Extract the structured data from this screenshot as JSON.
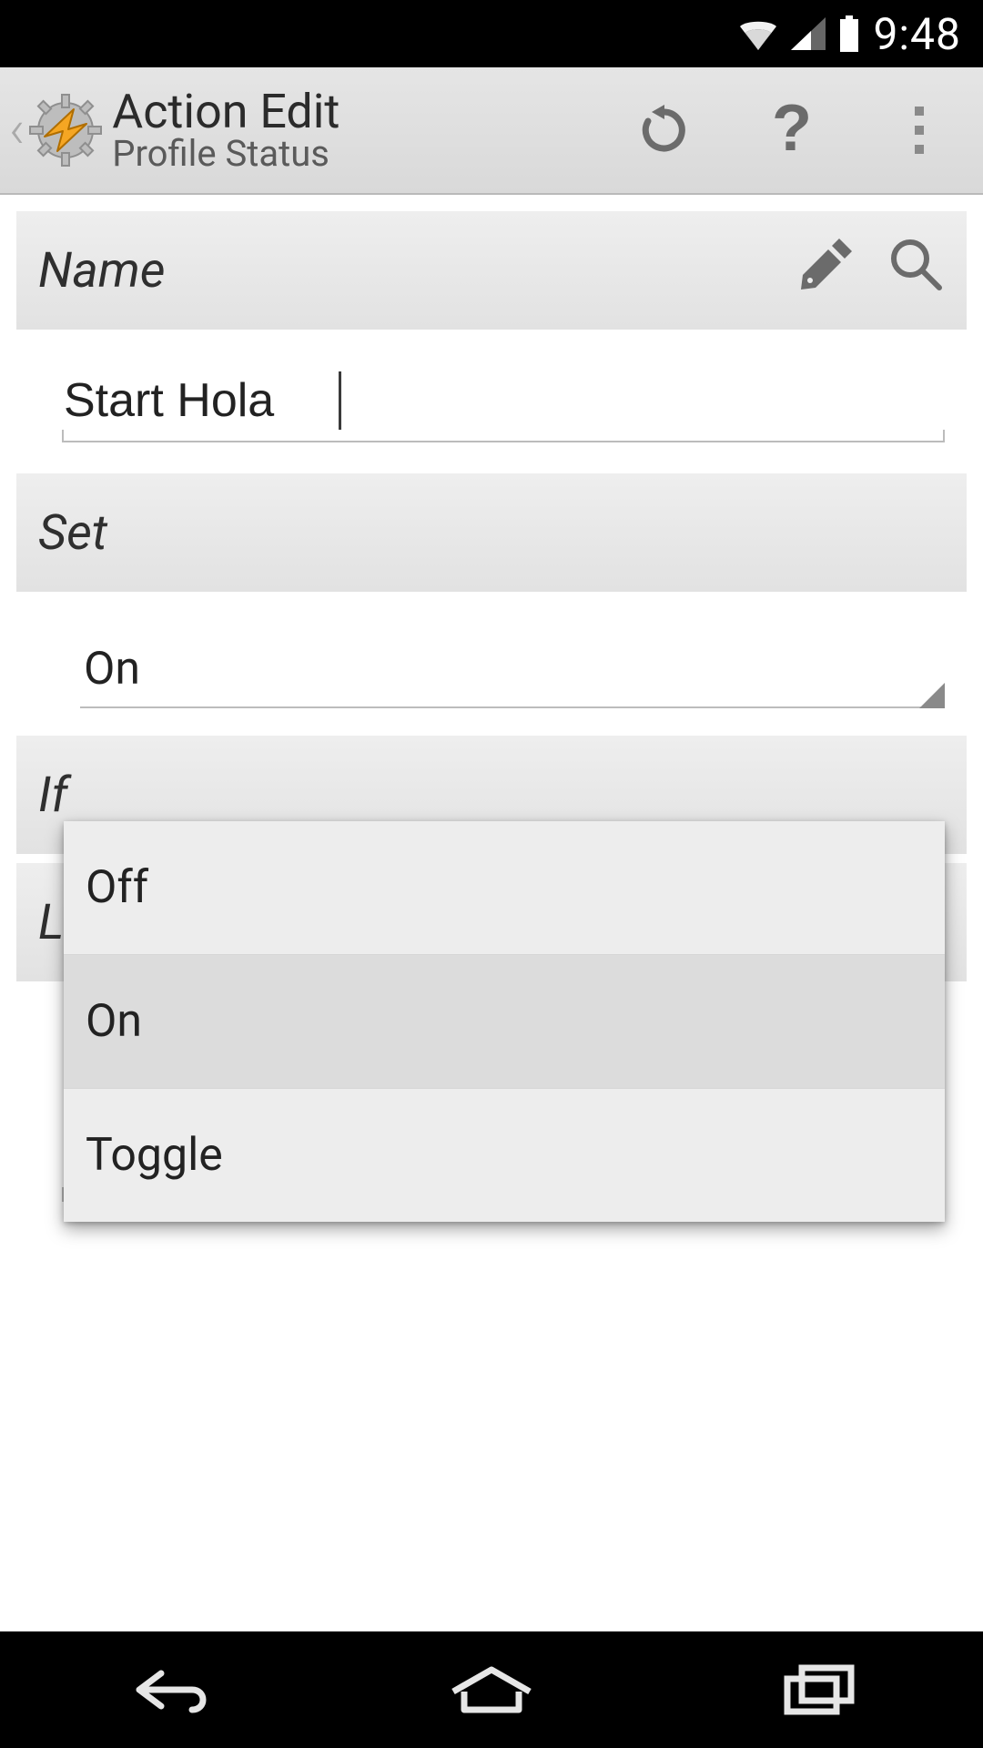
{
  "statusbar": {
    "time": "9:48",
    "wifi_icon": "wifi-icon",
    "cell_icon": "cell-signal-icon",
    "battery_icon": "battery-icon"
  },
  "actionbar": {
    "title": "Action Edit",
    "subtitle": "Profile Status",
    "refresh_icon": "refresh-icon",
    "help_icon": "help-icon",
    "overflow_icon": "overflow-menu-icon"
  },
  "sections": {
    "name": {
      "label": "Name",
      "value": "Start Hola",
      "edit_icon": "tag-edit-icon",
      "search_icon": "search-icon"
    },
    "set": {
      "label": "Set",
      "selected": "On",
      "options": [
        "Off",
        "On",
        "Toggle"
      ]
    },
    "if_label": "If",
    "l_label": "L"
  },
  "navbar": {
    "back": "back-icon",
    "home": "home-icon",
    "recent": "recent-apps-icon"
  }
}
